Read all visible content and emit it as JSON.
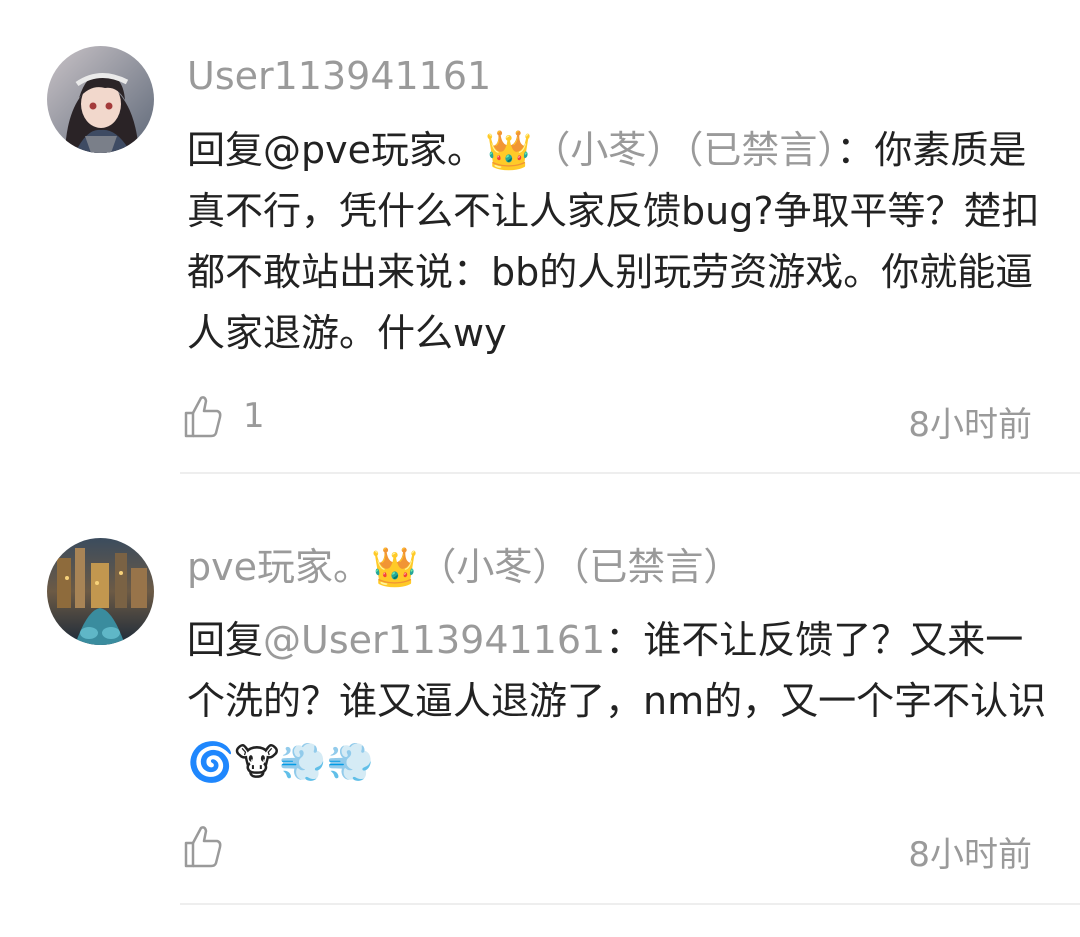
{
  "comments": [
    {
      "username": "User113941161",
      "reply_prefix": "回复",
      "reply_to": "@pve玩家。",
      "crown_icon": "👑",
      "reply_to_meta": "（小苳）（已禁言）",
      "colon": "：",
      "content": "你素质是真不行，凭什么不让人家反馈bug?争取平等？楚扣都不敢站出来说：bb的人别玩劳资游戏。你就能逼人家退游。什么wy",
      "like_count": "1",
      "time": "8小时前",
      "avatar_icon": "anime-girl-avatar-icon"
    },
    {
      "username_name": "pve玩家。",
      "username_crown": "👑",
      "username_meta": "（小苳）（已禁言）",
      "reply_prefix": "回复",
      "reply_to": "@User113941161",
      "colon": "：",
      "content": "谁不让反馈了？又来一个洗的？谁又逼人退游了，nm的，又一个字不认识",
      "emojis": "🌀🐮💨💨",
      "like_count": "",
      "time": "8小时前",
      "avatar_icon": "city-skyline-avatar-icon"
    }
  ],
  "colors": {
    "text_primary": "#222222",
    "text_secondary": "#9a9a9a",
    "divider": "#eeeeee"
  }
}
